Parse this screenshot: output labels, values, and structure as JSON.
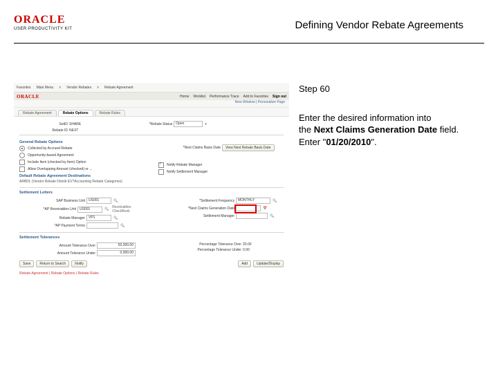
{
  "header": {
    "logo_main": "ORACLE",
    "logo_sub": "USER PRODUCTIVITY KIT",
    "title": "Defining Vendor Rebate Agreements"
  },
  "instructions": {
    "step_label": "Step 60",
    "line1": "Enter the desired information into",
    "line2_a": "the ",
    "line2_b": "Next Claims Generation Date",
    "line2_c": " field.",
    "line3_a": "Enter \"",
    "line3_b": "01/20/2010",
    "line3_c": "\"."
  },
  "ss": {
    "topmenu": [
      "Favorites",
      "Main Menu",
      " > ",
      "Vendor Rebates",
      " > ",
      "Rebate Agreement",
      " > "
    ],
    "secbar_right": [
      "Home",
      "Worklist",
      "Performance Trace",
      "Add to Favorites",
      "Sign out"
    ],
    "newwin": "New Window | Personalize Page",
    "tabs": [
      "Rebate Agreement",
      "Rebate Options",
      "Rebate Rules"
    ],
    "setid_lbl": "SetID",
    "setid_val": "SHARE",
    "rebid_lbl": "Rebate ID",
    "rebid_val": "NEXT",
    "status_lbl": "*Rebate Status",
    "status_val": "Open",
    "nbrd_lbl": "*Next Claims Basis Date",
    "nbrd_btn": "View Next Rebate Basis Date",
    "sec_options": "General Rebate Options",
    "opt1": "Collected by Accrued Rebate",
    "opt2": "Opportunity-based Agreement",
    "opt3": "Include Item (checked by Item) Option",
    "opt4": "Allow Overlapping Amount (checked) or ...",
    "sec_dests": "Default Rebate Agreement Destinations",
    "sec_dests_val": "ARBDL  (Vendor Rebate Distrib   EV?Accounting Rebate Categories)",
    "chk_a": "Notify Rebate Manager",
    "chk_b": "Notify Settlement Manager",
    "sec_letters": "Settlement Letters",
    "sap_lbl": "SAP Business Unit",
    "sap_val": "US001",
    "rcv_lbl": "*AP Receivables Unit",
    "rcv_val": "US001",
    "rcv_hint": "Receivables CheckBook",
    "freq_lbl": "*Settlement Frequency",
    "freq_val": "MONTHLY",
    "ncdate_lbl": "*Next Claims Generation Date",
    "rmgr_lbl": "Rebate Manager",
    "rmgr_val": "VP1",
    "smgr_lbl": "Settlement Manager",
    "smgr_val": "",
    "spay_lbl": "*AP Payment Terms",
    "spay_val": "",
    "sec_tol": "Settlement Tolerances",
    "ato_lbl": "Amount Tolerance Over",
    "ato_val": "50,000.00",
    "atu_lbl": "Amount Tolerance Under",
    "atu_val": "  0,000.00",
    "pto_lbl": "Percentage Tolerance Over",
    "pto_val": "20.00",
    "ptu_lbl": "Percentage Tolerance Under",
    "ptu_val": "0.00",
    "btn_save": "Save",
    "btn_return": "Return to Search",
    "btn_notify": "Notify",
    "btn_add": "Add",
    "btn_upd": "Update/Display",
    "footer": "Rebate Agreement | Rebate Options | Rebate Rules"
  }
}
